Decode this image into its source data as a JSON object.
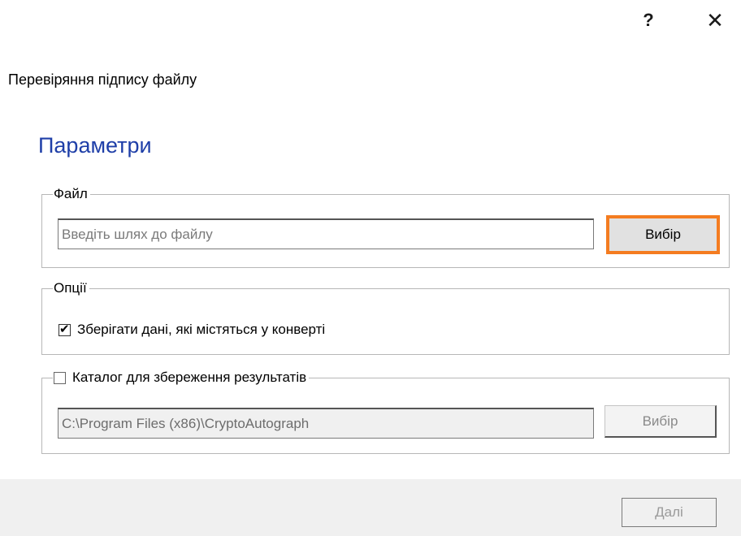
{
  "titlebar": {
    "help_label": "?",
    "close_label": "✕"
  },
  "dialog": {
    "title": "Перевіряння підпису файлу",
    "section_heading": "Параметри"
  },
  "file_group": {
    "legend": "Файл",
    "path_placeholder": "Введіть шлях до файлу",
    "path_value": "",
    "browse_label": "Вибір"
  },
  "options_group": {
    "legend": "Опції",
    "keep_envelope_data": {
      "label": "Зберігати дані, які містяться у конверті",
      "checked": true
    }
  },
  "output_group": {
    "legend": "Каталог для збереження результатів",
    "enabled": false,
    "path_value": "C:\\Program Files (x86)\\CryptoAutograph",
    "browse_label": "Вибір"
  },
  "footer": {
    "next_label": "Далі"
  },
  "colors": {
    "heading": "#1f3fa8",
    "highlight": "#f47c20",
    "footer_bg": "#f0f0f0"
  }
}
